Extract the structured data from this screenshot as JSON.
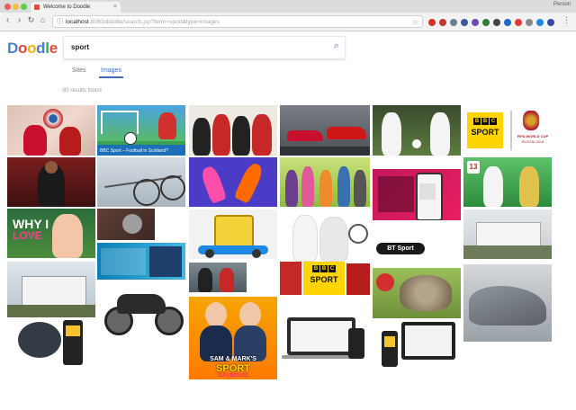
{
  "browser": {
    "tab_title": "Welcome to Doodle",
    "url_host": "localhost",
    "url_rest": ":8080/doodle/search.jsp?term=sport&type=images",
    "profile_label": "Person"
  },
  "app": {
    "logo_letters": [
      "D",
      "o",
      "o",
      "d",
      "l",
      "e"
    ],
    "logo_colors": [
      "#4a7fd4",
      "#e2493b",
      "#f4b400",
      "#4a7fd4",
      "#3aa757",
      "#e2493b"
    ],
    "search_value": "sport",
    "tabs": [
      "Sites",
      "Images"
    ],
    "active_tab": "Images",
    "result_count": "85 results found"
  },
  "tiles": {
    "caption_football": "BBC Sport – Football in Scotland?",
    "why_text": "WHY I",
    "love_text": "LOVE",
    "bbc_label": "SPORT",
    "bbc_block1": "B",
    "bbc_block2": "B",
    "bbc_block3": "C",
    "bt_sport_label": "BT Sport",
    "sam_mark_line1": "SAM & MARK'S",
    "sam_mark_line2": "SPORT",
    "sam_mark_line3": "SUPERSTARS",
    "wc_title": "FIFA WORLD CUP",
    "wc_sub": "RUSSIA 2018",
    "sticker_number": "13"
  },
  "colors": {
    "accent": "#3b6fc4",
    "bbc_yellow": "#ffd400"
  }
}
